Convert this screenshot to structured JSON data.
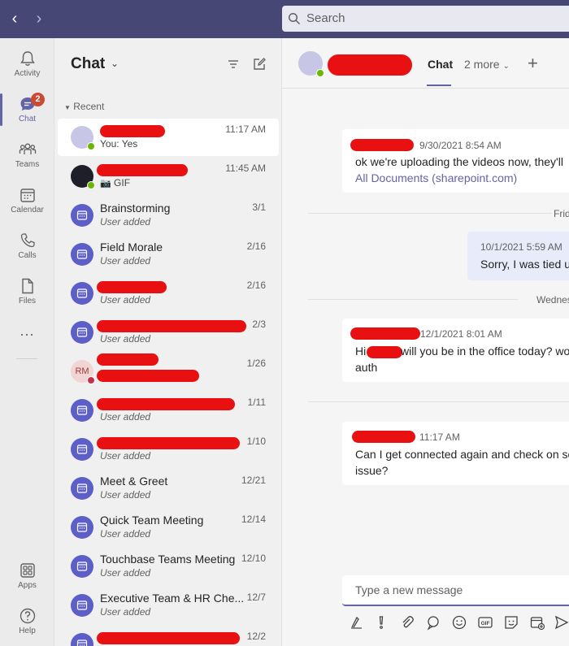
{
  "search": {
    "placeholder": "Search"
  },
  "rail": {
    "items": [
      {
        "label": "Activity",
        "icon": "bell-icon"
      },
      {
        "label": "Chat",
        "icon": "chat-icon",
        "badge": "2"
      },
      {
        "label": "Teams",
        "icon": "teams-icon"
      },
      {
        "label": "Calendar",
        "icon": "calendar-icon"
      },
      {
        "label": "Calls",
        "icon": "phone-icon"
      },
      {
        "label": "Files",
        "icon": "file-icon"
      }
    ],
    "more": "...",
    "bottom": [
      {
        "label": "Apps",
        "icon": "apps-icon"
      },
      {
        "label": "Help",
        "icon": "help-icon"
      }
    ]
  },
  "list": {
    "title": "Chat",
    "section": "Recent",
    "chats": [
      {
        "title": "",
        "sub": "You: Yes",
        "time": "11:17 AM"
      },
      {
        "title": "",
        "sub": "GIF",
        "time": "11:45 AM"
      },
      {
        "title": "Brainstorming",
        "sub": "User added",
        "time": "3/1"
      },
      {
        "title": "Field Morale",
        "sub": "User added",
        "time": "2/16"
      },
      {
        "title": "",
        "sub": "User added",
        "time": "2/16"
      },
      {
        "title": "",
        "sub": "User added",
        "time": "2/3"
      },
      {
        "title": "",
        "sub": "",
        "time": "1/26",
        "initials": "RM"
      },
      {
        "title": "",
        "sub": "User added",
        "time": "1/11"
      },
      {
        "title": "",
        "sub": "User added",
        "time": "1/10"
      },
      {
        "title": "Meet & Greet",
        "sub": "User added",
        "time": "12/21"
      },
      {
        "title": "Quick Team Meeting",
        "sub": "User added",
        "time": "12/14"
      },
      {
        "title": "Touchbase Teams Meeting",
        "sub": "User added",
        "time": "12/10"
      },
      {
        "title": "Executive Team & HR Che...",
        "sub": "User added",
        "time": "12/7"
      },
      {
        "title": "",
        "sub": "",
        "time": "12/2"
      }
    ]
  },
  "conversation": {
    "tab_chat": "Chat",
    "tab_more": "2 more",
    "messages": [
      {
        "meta": "9/30/2021 8:54 AM",
        "line1": "ok we're uploading the videos now, they'll",
        "link": "All Documents (sharepoint.com)"
      },
      {
        "meta": "10/1/2021 5:59 AM",
        "line1": "Sorry, I was tied u"
      },
      {
        "meta": "12/1/2021 8:01 AM",
        "line1": "will you be in the office today? wo",
        "prefix": "Hi",
        "line2": "auth"
      },
      {
        "meta": "11:17 AM",
        "line1": "Can I get connected again and check on so",
        "line2": "issue?"
      }
    ],
    "days": [
      "Frid",
      "Wednes"
    ],
    "compose_placeholder": "Type a new message"
  },
  "colors": {
    "brand": "#464775",
    "accent": "#6264a7",
    "redaction": "#e81010"
  }
}
